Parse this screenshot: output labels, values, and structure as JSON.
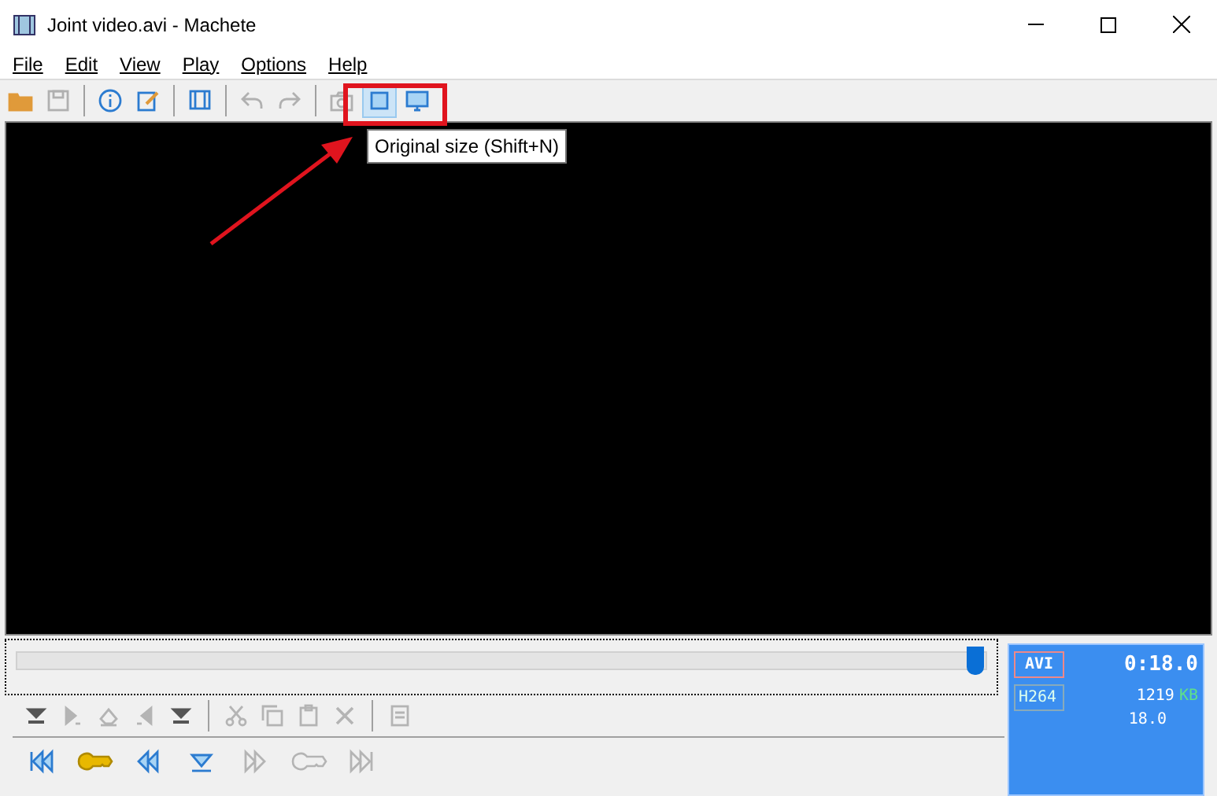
{
  "window": {
    "title": "Joint video.avi - Machete"
  },
  "menu": [
    "File",
    "Edit",
    "View",
    "Play",
    "Options",
    "Help"
  ],
  "toolbar": [
    {
      "kind": "open",
      "disabled": false,
      "selected": false
    },
    {
      "kind": "save",
      "disabled": true,
      "selected": false
    },
    {
      "kind": "sep"
    },
    {
      "kind": "info",
      "disabled": false,
      "selected": false
    },
    {
      "kind": "edit",
      "disabled": false,
      "selected": false
    },
    {
      "kind": "sep"
    },
    {
      "kind": "film",
      "disabled": false,
      "selected": false
    },
    {
      "kind": "sep"
    },
    {
      "kind": "undo",
      "disabled": true,
      "selected": false
    },
    {
      "kind": "redo",
      "disabled": true,
      "selected": false
    },
    {
      "kind": "sep"
    },
    {
      "kind": "camera",
      "disabled": true,
      "selected": false
    },
    {
      "kind": "square",
      "disabled": false,
      "selected": true
    },
    {
      "kind": "monitor",
      "disabled": false,
      "selected": false
    }
  ],
  "tooltip": "Original size (Shift+N)",
  "timeline": {
    "level": 0.99
  },
  "edit_toolbar": [
    {
      "kind": "mark",
      "disabled": false
    },
    {
      "kind": "markin",
      "disabled": true
    },
    {
      "kind": "erase",
      "disabled": true
    },
    {
      "kind": "markout",
      "disabled": true
    },
    {
      "kind": "mark",
      "disabled": false
    },
    {
      "kind": "sep"
    },
    {
      "kind": "cut",
      "disabled": true
    },
    {
      "kind": "copy",
      "disabled": true
    },
    {
      "kind": "paste",
      "disabled": true
    },
    {
      "kind": "delete",
      "disabled": true
    },
    {
      "kind": "sep"
    },
    {
      "kind": "doc",
      "disabled": true
    }
  ],
  "transport": [
    {
      "kind": "first",
      "disabled": false
    },
    {
      "kind": "key",
      "disabled": false
    },
    {
      "kind": "prev",
      "disabled": false
    },
    {
      "kind": "down",
      "disabled": false
    },
    {
      "kind": "next",
      "disabled": true
    },
    {
      "kind": "key",
      "disabled": true
    },
    {
      "kind": "last",
      "disabled": true
    }
  ],
  "info": {
    "container": "AVI",
    "time": "0:18.0",
    "codec": "H264",
    "size": "1219",
    "unit": "KB",
    "fps": "18.0"
  }
}
